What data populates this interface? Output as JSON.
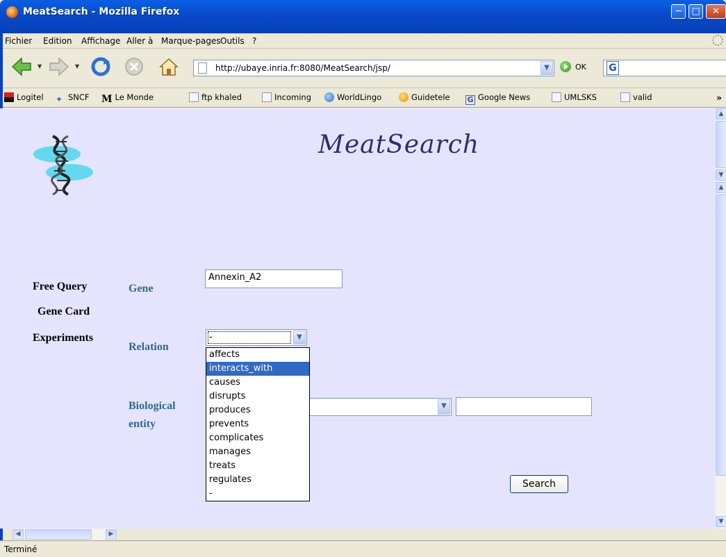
{
  "window": {
    "title": "MeatSearch - Mozilla Firefox"
  },
  "menu": [
    "Fichier",
    "Edition",
    "Affichage",
    "Aller à",
    "Marque-pages",
    "Outils",
    "?"
  ],
  "address": {
    "url": "http://ubaye.inria.fr:8080/MeatSearch/jsp/",
    "go_label": "OK"
  },
  "bookmarks": [
    "Logitel",
    "SNCF",
    "Le Monde",
    "ftp khaled",
    "Incoming",
    "WorldLingo",
    "Guidetele",
    "Google News",
    "UMLSKS",
    "valid"
  ],
  "page": {
    "title": "MeatSearch",
    "nav": [
      "Free Query",
      "Gene Card",
      "Experiments"
    ],
    "fields": {
      "gene_label": "Gene",
      "gene_value": "Annexin_A2",
      "relation_label": "Relation",
      "relation_value": "-",
      "bio_label_line1": "Biological",
      "bio_label_line2": "entity"
    },
    "relation_options": [
      "affects",
      "interacts_with",
      "causes",
      "disrupts",
      "produces",
      "prevents",
      "complicates",
      "manages",
      "treats",
      "regulates",
      "-"
    ],
    "relation_highlighted": "interacts_with",
    "search_label": "Search"
  },
  "status": "Terminé"
}
